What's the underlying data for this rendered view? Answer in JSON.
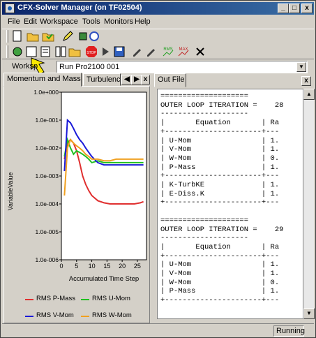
{
  "window": {
    "title": "CFX-Solver Manager (on TF02504)",
    "controls": {
      "minimize": "_",
      "maximize": "□",
      "close": "x"
    }
  },
  "menu": [
    "File",
    "Edit",
    "Workspace",
    "Tools",
    "Monitors",
    "Help"
  ],
  "workspace": {
    "label": "Worksp",
    "selected": "Run Pro2100 001"
  },
  "left_tabs": [
    "Momentum and Mass",
    "Turbulenc"
  ],
  "tab_scroll": {
    "prev": "◀",
    "next": "▶",
    "close": "x"
  },
  "chart_data": {
    "type": "line",
    "ylabel": "VariableValue",
    "xlabel": "Accumulated Time Step",
    "y_scale": "log",
    "ylim": [
      1e-06,
      1.0
    ],
    "y_ticks": [
      "1.0e+000",
      "1.0e-001",
      "1.0e-002",
      "1.0e-003",
      "1.0e-004",
      "1.0e-005",
      "1.0e-006"
    ],
    "x_ticks": [
      "0",
      "5",
      "10",
      "15",
      "20",
      "25"
    ],
    "xlim": [
      0,
      28
    ],
    "series": [
      {
        "name": "RMS P-Mass",
        "color": "#e03030",
        "x": [
          1,
          2,
          3,
          4,
          5,
          6,
          7,
          8,
          9,
          10,
          12,
          14,
          16,
          18,
          20,
          22,
          24,
          26,
          27
        ],
        "y": [
          0.004,
          0.015,
          0.02,
          0.015,
          0.008,
          0.003,
          0.001,
          0.0005,
          0.0003,
          0.0002,
          0.00013,
          0.00011,
          0.0001,
          0.0001,
          0.0001,
          0.0001,
          0.0001,
          0.00011,
          0.00012
        ]
      },
      {
        "name": "RMS U-Mom",
        "color": "#22c022",
        "x": [
          1,
          2,
          3,
          4,
          5,
          6,
          7,
          8,
          9,
          10,
          12,
          14,
          16,
          18,
          20,
          22,
          24,
          26,
          27
        ],
        "y": [
          0.005,
          0.02,
          0.01,
          0.006,
          0.008,
          0.007,
          0.006,
          0.005,
          0.004,
          0.003,
          0.0035,
          0.003,
          0.003,
          0.003,
          0.003,
          0.003,
          0.003,
          0.003,
          0.003
        ]
      },
      {
        "name": "RMS V-Mom",
        "color": "#1a1ad8",
        "x": [
          1,
          2,
          3,
          4,
          5,
          6,
          7,
          8,
          9,
          10,
          12,
          14,
          16,
          18,
          20,
          22,
          24,
          26,
          27
        ],
        "y": [
          0.0015,
          0.1,
          0.08,
          0.05,
          0.03,
          0.02,
          0.015,
          0.01,
          0.007,
          0.005,
          0.003,
          0.0025,
          0.0025,
          0.0025,
          0.0025,
          0.0025,
          0.0025,
          0.0025,
          0.0025
        ]
      },
      {
        "name": "RMS W-Mom",
        "color": "#f0a020",
        "x": [
          1,
          2,
          3,
          4,
          5,
          6,
          7,
          8,
          9,
          10,
          12,
          14,
          16,
          18,
          20,
          22,
          24,
          26,
          27
        ],
        "y": [
          0.0002,
          0.01,
          0.02,
          0.015,
          0.012,
          0.01,
          0.008,
          0.006,
          0.005,
          0.004,
          0.004,
          0.0035,
          0.0035,
          0.004,
          0.004,
          0.004,
          0.004,
          0.004,
          0.004
        ]
      }
    ]
  },
  "right_tab": "Out File",
  "out_lines": [
    "====================",
    "OUTER LOOP ITERATION =    28",
    "--------------------",
    "|       Equation       | Ra",
    "+----------------------+---",
    "| U-Mom                | 1.",
    "| V-Mom                | 1.",
    "| W-Mom                | 0.",
    "| P-Mass               | 1.",
    "+----------------------+---",
    "| K-TurbKE             | 1.",
    "| E-Diss.K             | 1.",
    "+----------------------+---",
    "",
    "====================",
    "OUTER LOOP ITERATION =    29",
    "--------------------",
    "|       Equation       | Ra",
    "+----------------------+---",
    "| U-Mom                | 1.",
    "| V-Mom                | 1.",
    "| W-Mom                | 0.",
    "| P-Mass               | 1.",
    "+----------------------+---"
  ],
  "status": "Running"
}
